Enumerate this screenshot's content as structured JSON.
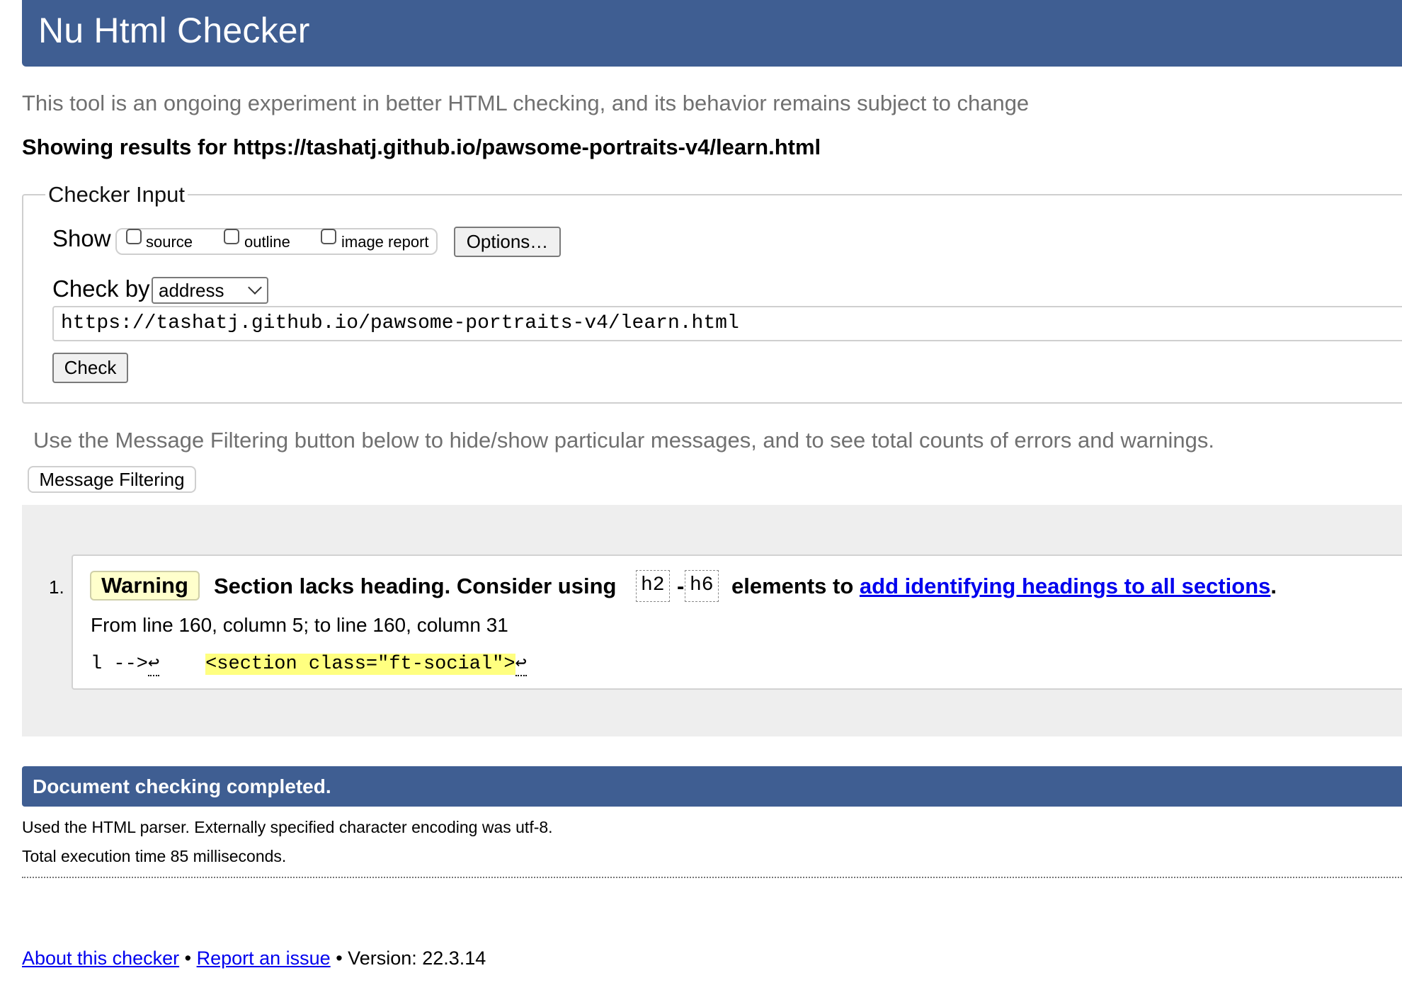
{
  "header": {
    "title": "Nu Html Checker"
  },
  "tagline": "This tool is an ongoing experiment in better HTML checking, and its behavior remains subject to change",
  "results_heading": "Showing results for https://tashatj.github.io/pawsome-portraits-v4/learn.html",
  "checker_input": {
    "legend": "Checker Input",
    "show_label": "Show",
    "show_options": [
      {
        "label": "source",
        "checked": false
      },
      {
        "label": "outline",
        "checked": false
      },
      {
        "label": "image report",
        "checked": false
      }
    ],
    "options_button": "Options…",
    "check_by_label": "Check by",
    "check_by_value": "address",
    "url_value": "https://tashatj.github.io/pawsome-portraits-v4/learn.html",
    "check_button": "Check"
  },
  "filter": {
    "hint": "Use the Message Filtering button below to hide/show particular messages, and to see total counts of errors and warnings.",
    "button": "Message Filtering"
  },
  "messages": [
    {
      "number": "1.",
      "type": "Warning",
      "text_before": "Section lacks heading. Consider using",
      "code_start": "h2",
      "dash": "-",
      "code_end": "h6",
      "text_middle": "elements to",
      "link_text": "add identifying headings to all sections",
      "text_after": ".",
      "location": "From line 160, column 5; to line 160, column 31",
      "extract_prefix": "l -->",
      "extract_lb1": "↩",
      "extract_gap": "    ",
      "extract_highlight": "<section class=\"ft-social\">",
      "extract_lb2": "↩"
    }
  ],
  "completion": {
    "title": "Document checking completed.",
    "parser_info": "Used the HTML parser. Externally specified character encoding was utf-8.",
    "time_info": "Total execution time 85 milliseconds."
  },
  "footer": {
    "about_link": "About this checker",
    "separator_1": " • ",
    "report_link": "Report an issue",
    "separator_2": " • ",
    "version": "Version: 22.3.14"
  },
  "colors": {
    "header_bg": "#3f5e92",
    "warning_badge_bg": "#ffffcc",
    "highlight": "#ffff80",
    "link": "#0000ee"
  }
}
